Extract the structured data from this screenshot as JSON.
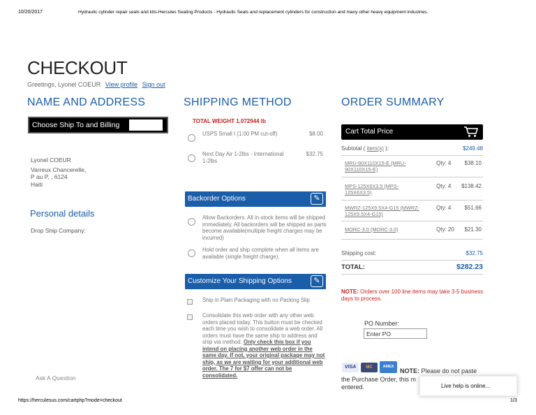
{
  "print_header": {
    "date": "10/20/2017",
    "title": "Hydraulic cylinder repair seals and kits-Hercules Sealing Products - Hydraulic Seals and replacement cylinders for construction and many other heavy equipment industries."
  },
  "print_footer": {
    "url": "https://herculesus.com/cartphp?mode=checkout",
    "page": "1/3"
  },
  "page_title": "CHECKOUT",
  "greeting": {
    "text": "Greetings, Lyonel COEUR",
    "view_profile": "View profile",
    "sign_out": "Sign out"
  },
  "name_address": {
    "heading": "NAME AND ADDRESS",
    "choose_button": "Choose Ship To and Billing",
    "address": [
      "Lyonel COEUR",
      "Varreux Chancerelle,",
      "P au P, , 6124",
      "Haiti"
    ],
    "personal_heading": "Personal details",
    "drop_ship_label": "Drop Ship Company:",
    "ask_question": "Ask A Question"
  },
  "shipping": {
    "heading": "SHIPPING METHOD",
    "total_weight": "TOTAL WEIGHT 1.072944 lb",
    "options": [
      {
        "label": "USPS Small I (1:00 PM cut-off)",
        "price": "$8.00"
      },
      {
        "label": "Next Day Air 1-2lbs - International 1-2lbs",
        "price": "$32.75"
      }
    ],
    "backorder_title": "Backorder Options",
    "backorder_options": [
      {
        "label": "Allow Backorders. All in-stock items will be shipped immediately. All backorders will be shipped as parts become available(multiple freight charges may be incurred)"
      },
      {
        "label": "Hold order and ship complete when all items are available (single freight charge)."
      }
    ],
    "customize_title": "Customize Your Shipping Options",
    "plain_packaging": "Ship in Plain Packaging with no Packing Slip",
    "consolidate": "Consolidate this web order with any other web orders placed today. This button must be checked each time you wish to consolidate a web order. All orders must have the same ship to address and ship via method.",
    "consolidate_bold": "Only check this box if you intend on placing another web order in the same day. If not, your original package may not ship, as we are waiting for your additional web order. The 7 for $7 offer can not be consolidated."
  },
  "order_summary": {
    "heading": "ORDER SUMMARY",
    "cart_title": "Cart Total Price",
    "subtotal_label": "Subtotal (",
    "subtotal_link": "item(s)",
    "subtotal_tail": "):",
    "subtotal_value": "$249.48",
    "items": [
      {
        "name": "MRU-90X110X15-E (MRU-90X110X15-E)",
        "qty": "Qty: 4",
        "price": "$38.10"
      },
      {
        "name": "MPS-125X6X3.5 (MPS-125X6X3.5)",
        "qty": "Qty: 4",
        "price": "$138.42"
      },
      {
        "name": "MWRZ-125X9.5X4-G15 (MWRZ-125X9.5X4-G15)",
        "qty": "Qty: 4",
        "price": "$51.66"
      },
      {
        "name": "MORC-3.0 (MORC-3.0)",
        "qty": "Qty: 20",
        "price": "$21.30"
      }
    ],
    "shipping_label": "Shipping cost:",
    "shipping_value": "$32.75",
    "total_label": "TOTAL:",
    "total_value": "$282.23",
    "note_label": "NOTE:",
    "note_text": "Orders over 100 line items may take 3-5 business days to process.",
    "po_label": "PO Number:",
    "po_value": "Enter PO",
    "cards": [
      "VISA",
      "MC",
      "AMEX"
    ],
    "bottom_note_label": "NOTE:",
    "bottom_note_text": "Please do not paste",
    "bottom_note_line2": "the Purchase Order, this m",
    "bottom_note_line3": "entered."
  },
  "chat": {
    "label": "Live help is online..."
  },
  "colors": {
    "accent": "#1a5da8",
    "alert": "#cc1f1f",
    "bar_dark": "#000000"
  }
}
